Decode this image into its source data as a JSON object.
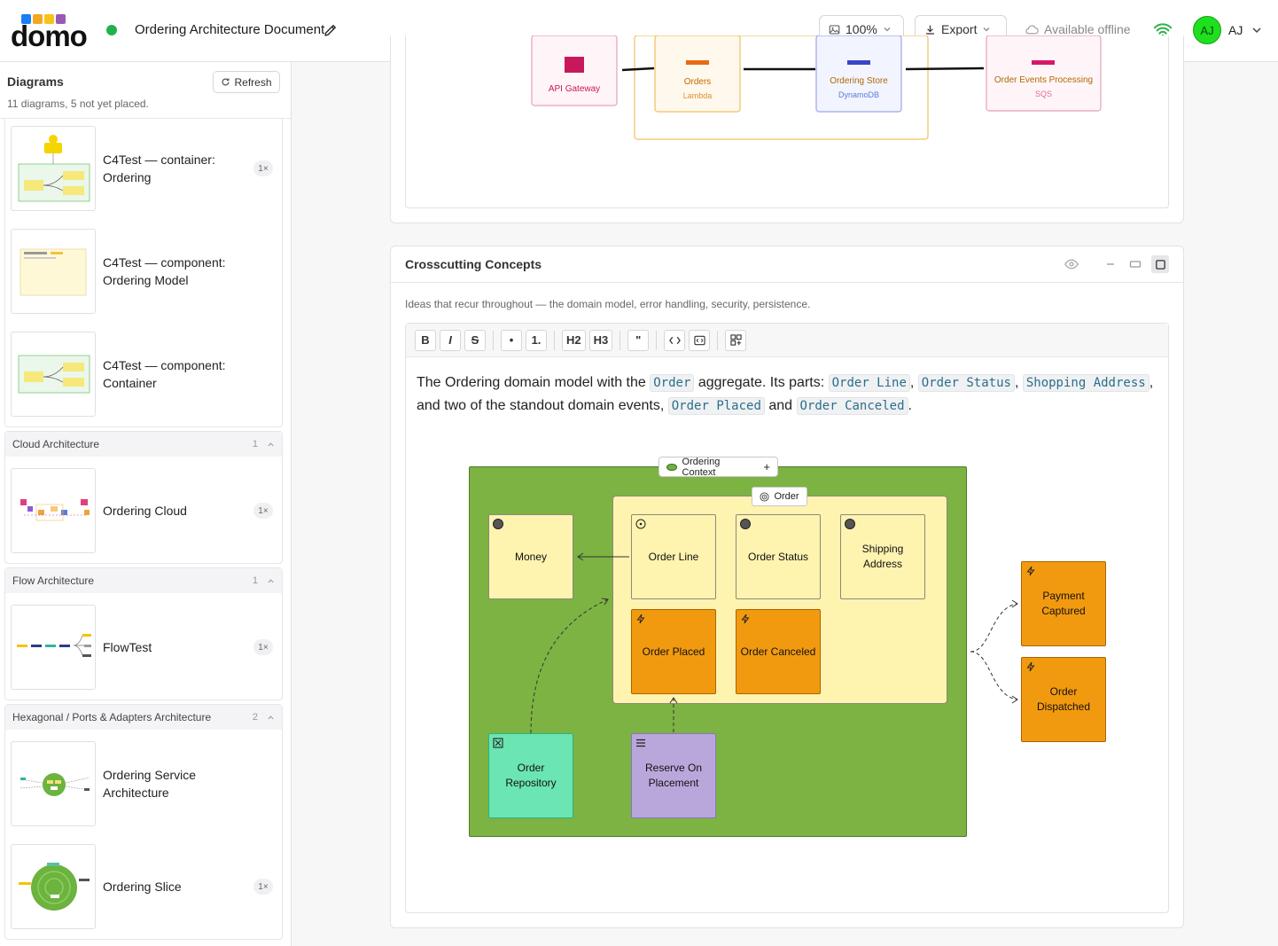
{
  "header": {
    "logo_text": "domo",
    "logo_colors": [
      "#1a7ef5",
      "#f5a623",
      "#f7c21a",
      "#9b59b6"
    ],
    "doc_title": "Ordering Architecture Document",
    "zoom": "100%",
    "export_label": "Export",
    "offline_label": "Available offline",
    "avatar_initials": "AJ",
    "avatar_name": "AJ"
  },
  "sidebar": {
    "title": "Diagrams",
    "refresh_label": "Refresh",
    "subtitle": "11 diagrams, 5 not yet placed.",
    "items_top": [
      {
        "label": "C4Test — container: Ordering",
        "badge": "1×"
      },
      {
        "label": "C4Test — component: Ordering Model",
        "badge": ""
      },
      {
        "label": "C4Test — component: Container",
        "badge": ""
      }
    ],
    "groups": [
      {
        "name": "Cloud Architecture",
        "count": "1",
        "items": [
          {
            "label": "Ordering Cloud",
            "badge": "1×"
          }
        ]
      },
      {
        "name": "Flow Architecture",
        "count": "1",
        "items": [
          {
            "label": "FlowTest",
            "badge": "1×"
          }
        ]
      },
      {
        "name": "Hexagonal / Ports & Adapters Architecture",
        "count": "2",
        "items": [
          {
            "label": "Ordering Service Architecture",
            "badge": ""
          },
          {
            "label": "Ordering Slice",
            "badge": "1×"
          }
        ]
      }
    ]
  },
  "cloud_diagram": {
    "nodes": [
      {
        "label": "API Gateway",
        "sub": ""
      },
      {
        "label": "Orders",
        "sub": "Lambda"
      },
      {
        "label": "Ordering Store",
        "sub": "DynamoDB"
      },
      {
        "label": "Order Events Processing",
        "sub": "SQS"
      }
    ]
  },
  "crosscutting": {
    "title": "Crosscutting Concepts",
    "description": "Ideas that recur throughout — the domain model, error handling, security, persistence.",
    "toolbar": [
      "B",
      "I",
      "S",
      "•",
      "1.",
      "H2",
      "H3",
      "\""
    ],
    "paragraph": {
      "t1": "The Ordering domain model with the ",
      "c1": "Order",
      "t2": " aggregate. Its parts: ",
      "c2": "Order Line",
      "t3": ", ",
      "c3": "Order Status",
      "t4": ", ",
      "c4": "Shopping Address",
      "t5": ", and two of the standout domain events, ",
      "c5": "Order Placed",
      "t6": " and ",
      "c6": "Order Canceled",
      "t7": "."
    },
    "diagram": {
      "context_label": "Ordering Context",
      "aggregate_label": "Order",
      "nodes": {
        "money": "Money",
        "order_line": "Order Line",
        "order_status": "Order Status",
        "shipping_address": "Shipping Address",
        "order_placed": "Order Placed",
        "order_canceled": "Order Canceled",
        "order_repository": "Order Repository",
        "reserve_on_placement": "Reserve On Placement",
        "payment_captured": "Payment Captured",
        "order_dispatched": "Order Dispatched"
      },
      "colors": {
        "context": "#7cb342",
        "aggregate": "#fff3b0",
        "value": "#fff3b0",
        "event": "#f29a0f",
        "repository": "#6be5b2",
        "policy": "#b9a7dc"
      }
    }
  }
}
